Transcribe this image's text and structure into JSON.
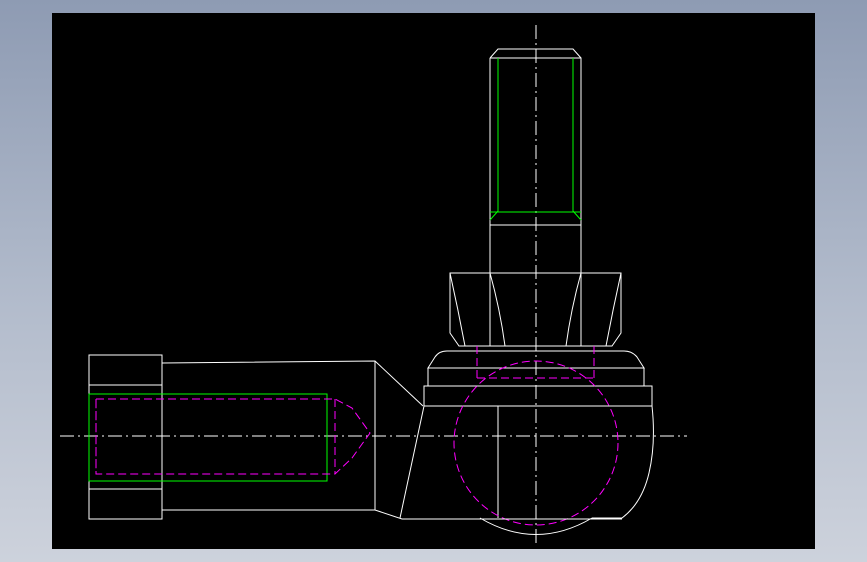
{
  "viewport": {
    "background": "#000000",
    "description_icons": [
      "ball-joint-drawing"
    ]
  },
  "colors": {
    "outline": "#ffffff",
    "thread": "#00ff00",
    "hidden": "#ff00ff",
    "centerline": "#ffffff",
    "background_top": "#8e9bb3",
    "background_bottom": "#cdd2dc"
  },
  "drawing": {
    "type": "cad-2d-view",
    "part": "angle-joint-ball-socket",
    "layers": [
      "outline",
      "thread",
      "hidden",
      "centerline"
    ]
  }
}
